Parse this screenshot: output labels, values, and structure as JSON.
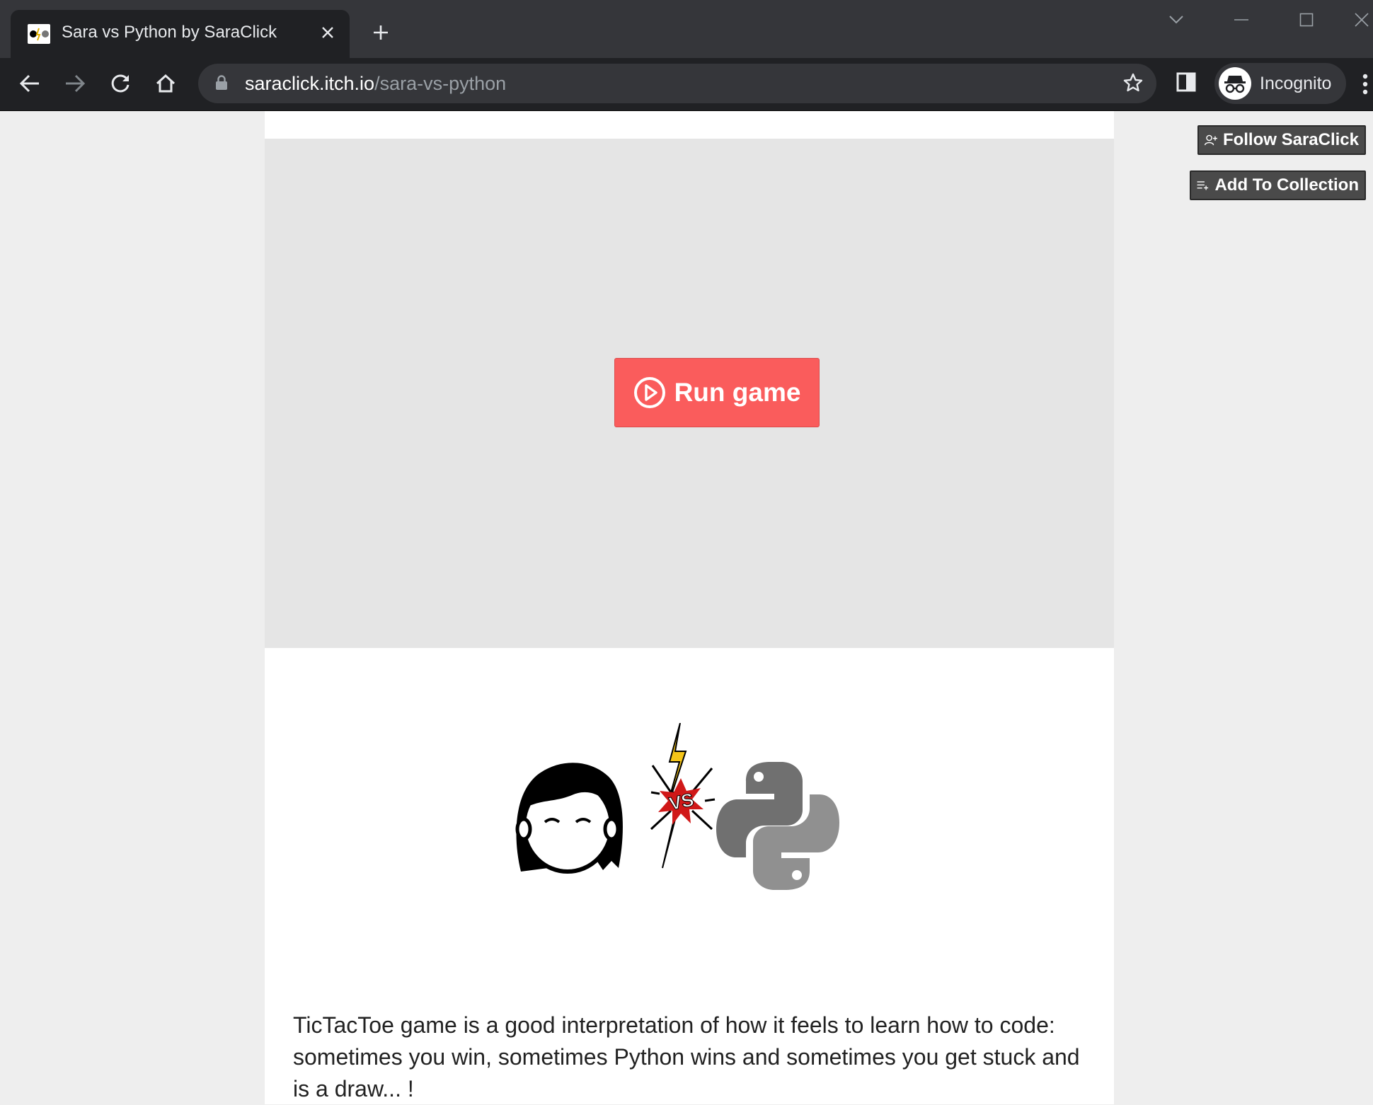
{
  "browser": {
    "tab": {
      "title": "Sara vs Python by SaraClick",
      "favicon": "game-favicon"
    },
    "url_host": "saraclick.itch.io",
    "url_path": "/sara-vs-python",
    "profile_label": "Incognito",
    "icons": [
      "back-icon",
      "forward-icon",
      "reload-icon",
      "home-icon",
      "lock-icon",
      "star-icon",
      "side-panel-icon",
      "incognito-icon",
      "menu-icon",
      "close-icon",
      "plus-icon",
      "chevron-down-icon",
      "minimize-icon",
      "maximize-icon"
    ]
  },
  "page": {
    "follow_label": "Follow SaraClick",
    "collection_label": "Add To Collection",
    "run_game_label": "Run game",
    "description": "TicTacToe game is a good interpretation of how it feels to learn how to code: sometimes you win, sometimes Python wins and sometimes you get stuck and is a draw... !",
    "hero_art_labels": {
      "vs": "VS"
    }
  },
  "colors": {
    "run_button": "#fa5c5c",
    "side_button": "#4a4a4a",
    "game_frame": "#e5e5e5",
    "browser_frame": "#35363a",
    "browser_toolbar": "#202124",
    "python_logo": "#707070",
    "lightning": "#f5c518"
  }
}
